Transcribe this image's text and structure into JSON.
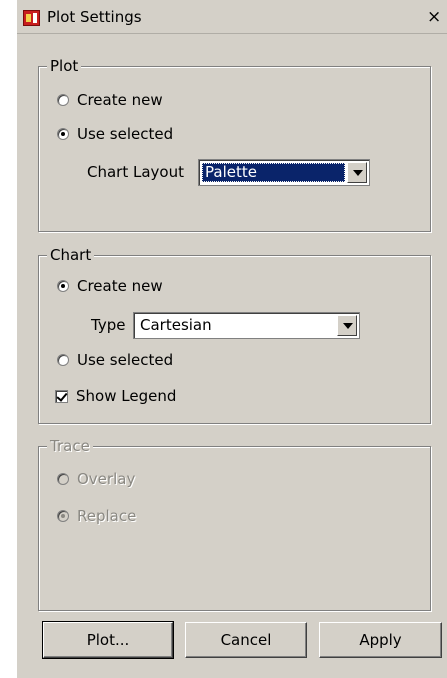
{
  "window": {
    "title": "Plot Settings",
    "close_glyph": "×"
  },
  "plot": {
    "legend": "Plot",
    "create_new": "Create new",
    "use_selected": "Use selected",
    "selected_option": "use_selected",
    "chart_layout_label": "Chart Layout",
    "chart_layout_value": "Palette"
  },
  "chart": {
    "legend": "Chart",
    "create_new": "Create new",
    "type_label": "Type",
    "type_value": "Cartesian",
    "use_selected": "Use selected",
    "show_legend": "Show Legend",
    "show_legend_checked": true,
    "selected_option": "create_new"
  },
  "trace": {
    "legend": "Trace",
    "overlay": "Overlay",
    "replace": "Replace",
    "selected_option": "replace",
    "enabled": false
  },
  "buttons": {
    "plot": "Plot...",
    "cancel": "Cancel",
    "apply": "Apply"
  }
}
